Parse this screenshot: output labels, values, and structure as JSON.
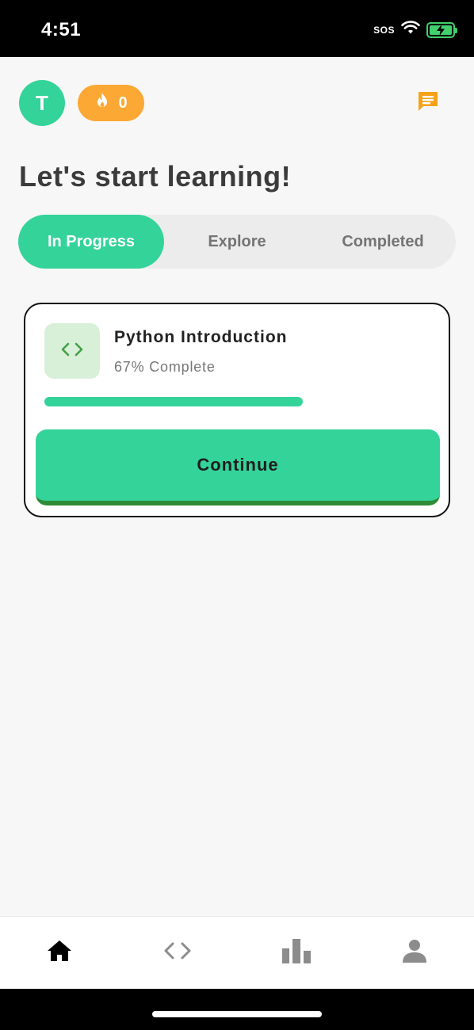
{
  "status_bar": {
    "time": "4:51",
    "sos": "SOS",
    "icons": [
      "wifi-icon",
      "battery-charging-icon"
    ]
  },
  "header": {
    "avatar_initial": "T",
    "streak_count": "0",
    "streak_icon": "flame-icon",
    "chat_icon": "message-icon"
  },
  "title": "Let's start learning!",
  "tabs": [
    {
      "label": "In Progress",
      "active": true
    },
    {
      "label": "Explore",
      "active": false
    },
    {
      "label": "Completed",
      "active": false
    }
  ],
  "course_card": {
    "icon": "code-icon",
    "title": "Python Introduction",
    "progress_text": "67% Complete",
    "progress": 0.67,
    "button_label": "Continue"
  },
  "bottom_nav": [
    {
      "name": "home",
      "icon": "home-icon",
      "active": true
    },
    {
      "name": "code",
      "icon": "code-icon",
      "active": false
    },
    {
      "name": "stats",
      "icon": "bar-chart-icon",
      "active": false
    },
    {
      "name": "profile",
      "icon": "person-icon",
      "active": false
    }
  ],
  "colors": {
    "accent": "#34d399",
    "streak": "#fba834",
    "chat": "#f5a219",
    "button_shadow": "#2e8b37"
  }
}
